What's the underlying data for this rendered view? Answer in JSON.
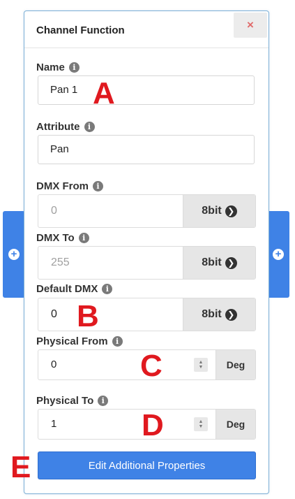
{
  "panel": {
    "title": "Channel Function",
    "close_label": "×"
  },
  "fields": {
    "name": {
      "label": "Name",
      "value": "Pan 1"
    },
    "attribute": {
      "label": "Attribute",
      "value": "Pan"
    },
    "dmx_from": {
      "label": "DMX From",
      "value": "0",
      "addon": "8bit"
    },
    "dmx_to": {
      "label": "DMX To",
      "value": "255",
      "addon": "8bit"
    },
    "default_dmx": {
      "label": "Default DMX",
      "value": "0",
      "addon": "8bit"
    },
    "physical_from": {
      "label": "Physical From",
      "value": "0",
      "unit": "Deg"
    },
    "physical_to": {
      "label": "Physical To",
      "value": "1",
      "unit": "Deg"
    }
  },
  "buttons": {
    "edit_additional": "Edit Additional Properties"
  },
  "icons": {
    "info": "i",
    "plus": "+",
    "chevron": "❯",
    "spinner_up": "▲",
    "spinner_down": "▼"
  },
  "markers": [
    "A",
    "B",
    "C",
    "D",
    "E"
  ],
  "colors": {
    "accent": "#3f82e6",
    "marker": "#e0191f",
    "close": "#e06a6a"
  }
}
